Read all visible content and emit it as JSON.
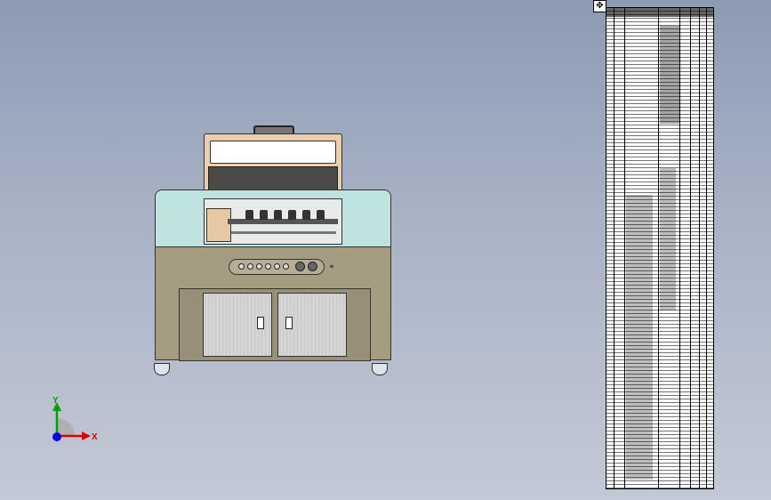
{
  "window": {
    "title": ""
  },
  "triad": {
    "y_label": "Y",
    "x_label": "X"
  },
  "bom": {
    "icon": "move-handle-icon"
  },
  "colors": {
    "background_top": "#8d9bb2",
    "background_bottom": "#c3c9d6",
    "machine_upper": "#bfe3df",
    "machine_lower": "#a59c82",
    "lid": "#e9cfb0",
    "x_axis": "#e00000",
    "y_axis": "#00a000",
    "z_axis": "#0000e0"
  }
}
